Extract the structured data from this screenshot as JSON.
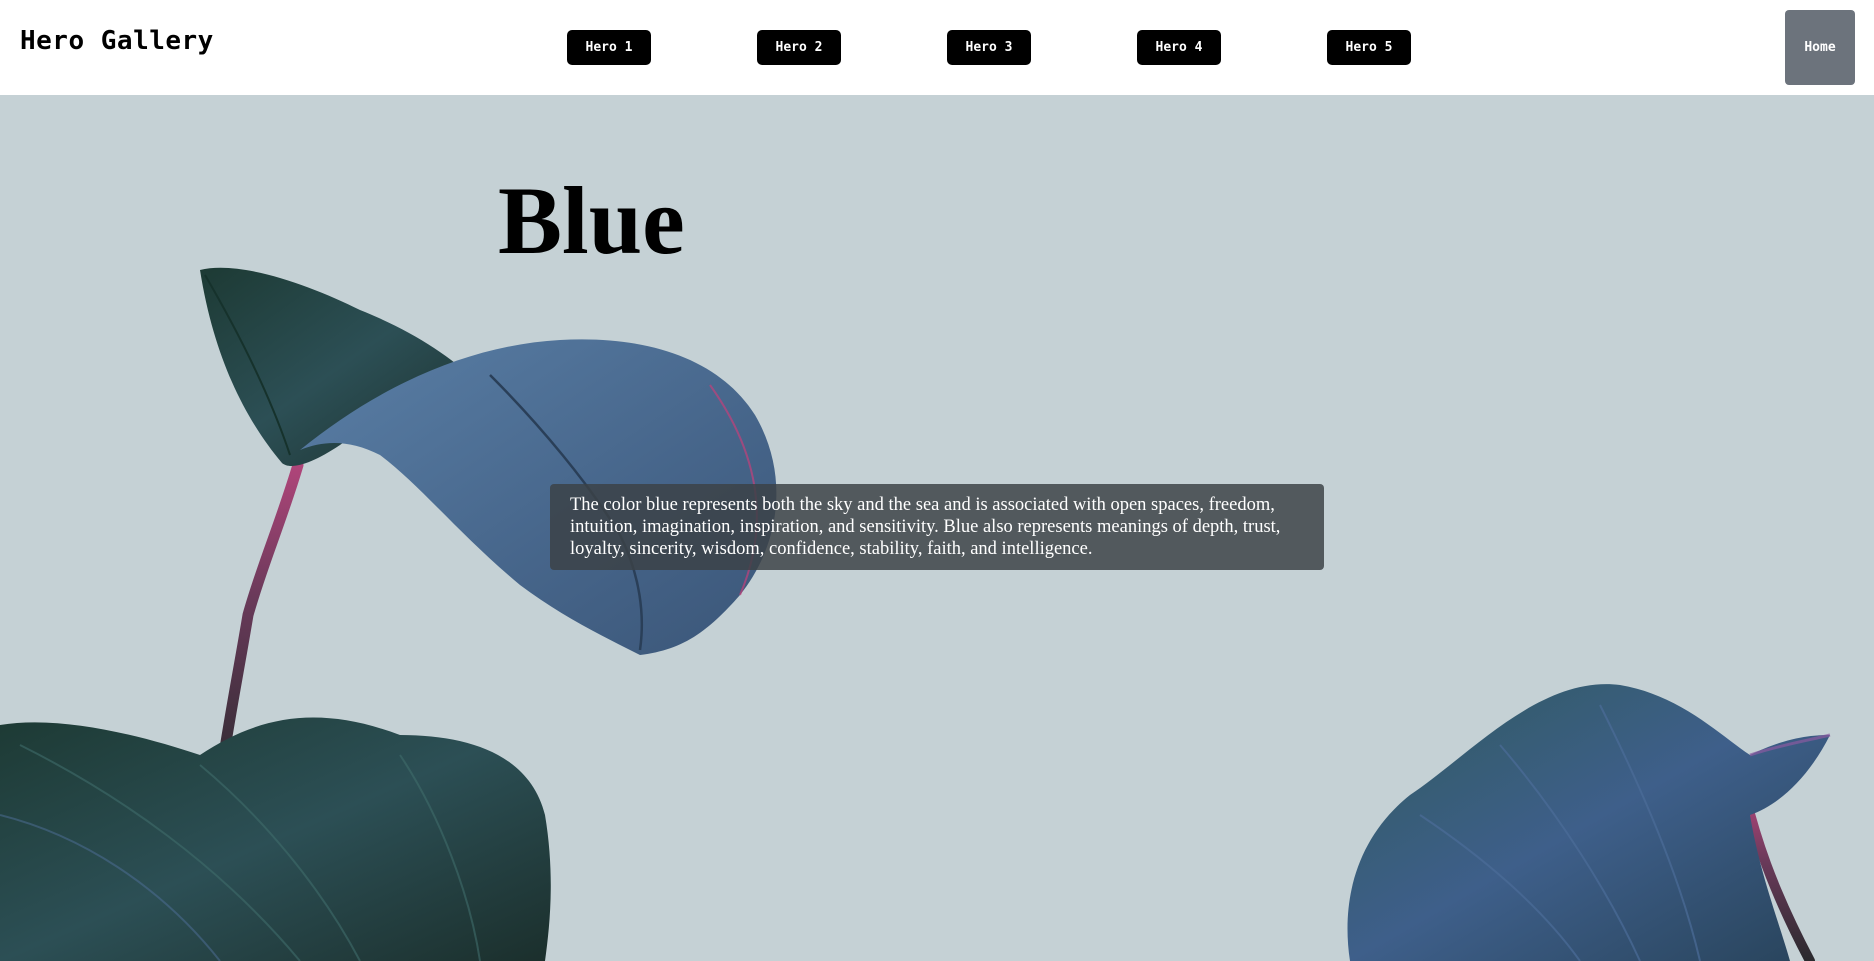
{
  "header": {
    "brand": "Hero Gallery",
    "nav": [
      "Hero 1",
      "Hero 2",
      "Hero 3",
      "Hero 4",
      "Hero 5"
    ],
    "home_label": "Home"
  },
  "hero": {
    "title": "Blue",
    "description": "The color blue represents both the sky and the sea and is associated with open spaces, freedom, intuition, imagination, inspiration, and sensitivity. Blue also represents meanings of depth, trust, loyalty, sincerity, wisdom, confidence, stability, faith, and intelligence.",
    "background_image": "blue-calathea-leaves-photo"
  },
  "colors": {
    "hero_background": "#c5d1d5",
    "nav_button": "#000000",
    "home_button": "#6c737c",
    "overlay": "#3c4246"
  }
}
